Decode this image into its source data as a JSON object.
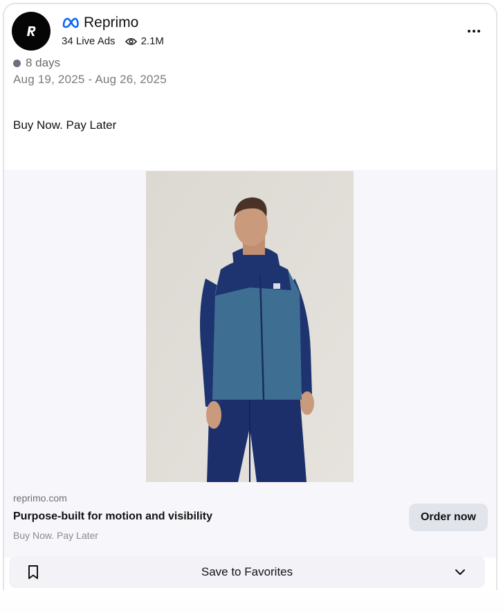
{
  "ad": {
    "brand_name": "Reprimo",
    "live_ads": "34 Live Ads",
    "views": "2.1M",
    "duration": "8 days",
    "date_range": "Aug 19, 2025 - Aug 26, 2025",
    "primary_text": "Buy Now. Pay Later"
  },
  "link": {
    "domain": "reprimo.com",
    "title": "Purpose-built for motion and visibility",
    "description": "Buy Now. Pay Later",
    "cta_label": "Order now"
  },
  "favorites": {
    "label": "Save to Favorites"
  },
  "icons": {
    "platform": "meta-icon",
    "views": "eye-icon",
    "menu": "more-icon",
    "bookmark": "bookmark-icon",
    "expand": "chevron-down-icon"
  },
  "colors": {
    "meta_blue": "#0866ff",
    "cta_bg": "#e2e4ec",
    "status_dot": "#6b7080"
  }
}
